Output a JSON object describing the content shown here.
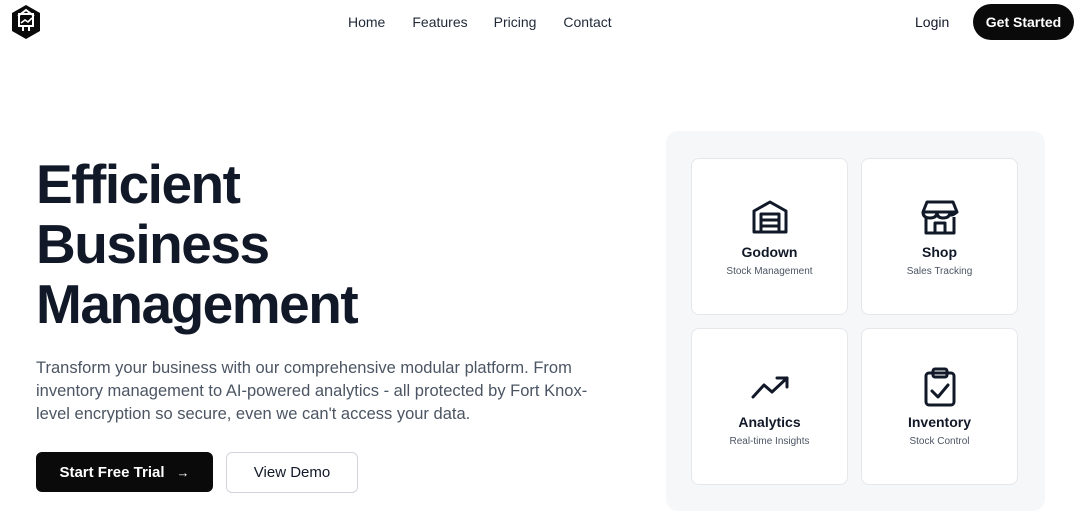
{
  "nav": {
    "links": [
      "Home",
      "Features",
      "Pricing",
      "Contact"
    ],
    "login_label": "Login",
    "cta_label": "Get Started"
  },
  "hero": {
    "title_lines": [
      "Efficient",
      "Business",
      "Management"
    ],
    "description": "Transform your business with our comprehensive modular platform. From inventory management to AI-powered analytics - all protected by Fort Knox-level encryption so secure, even we can't access your data.",
    "primary_label": "Start Free Trial",
    "secondary_label": "View Demo"
  },
  "modules": [
    {
      "title": "Godown",
      "subtitle": "Stock Management",
      "icon": "warehouse-icon"
    },
    {
      "title": "Shop",
      "subtitle": "Sales Tracking",
      "icon": "store-icon"
    },
    {
      "title": "Analytics",
      "subtitle": "Real-time Insights",
      "icon": "trending-up-icon"
    },
    {
      "title": "Inventory",
      "subtitle": "Stock Control",
      "icon": "clipboard-check-icon"
    }
  ],
  "colors": {
    "primary": "#0a0a0a",
    "panel_bg": "#f6f7f8",
    "text": "#111827",
    "muted": "#4b5563"
  }
}
